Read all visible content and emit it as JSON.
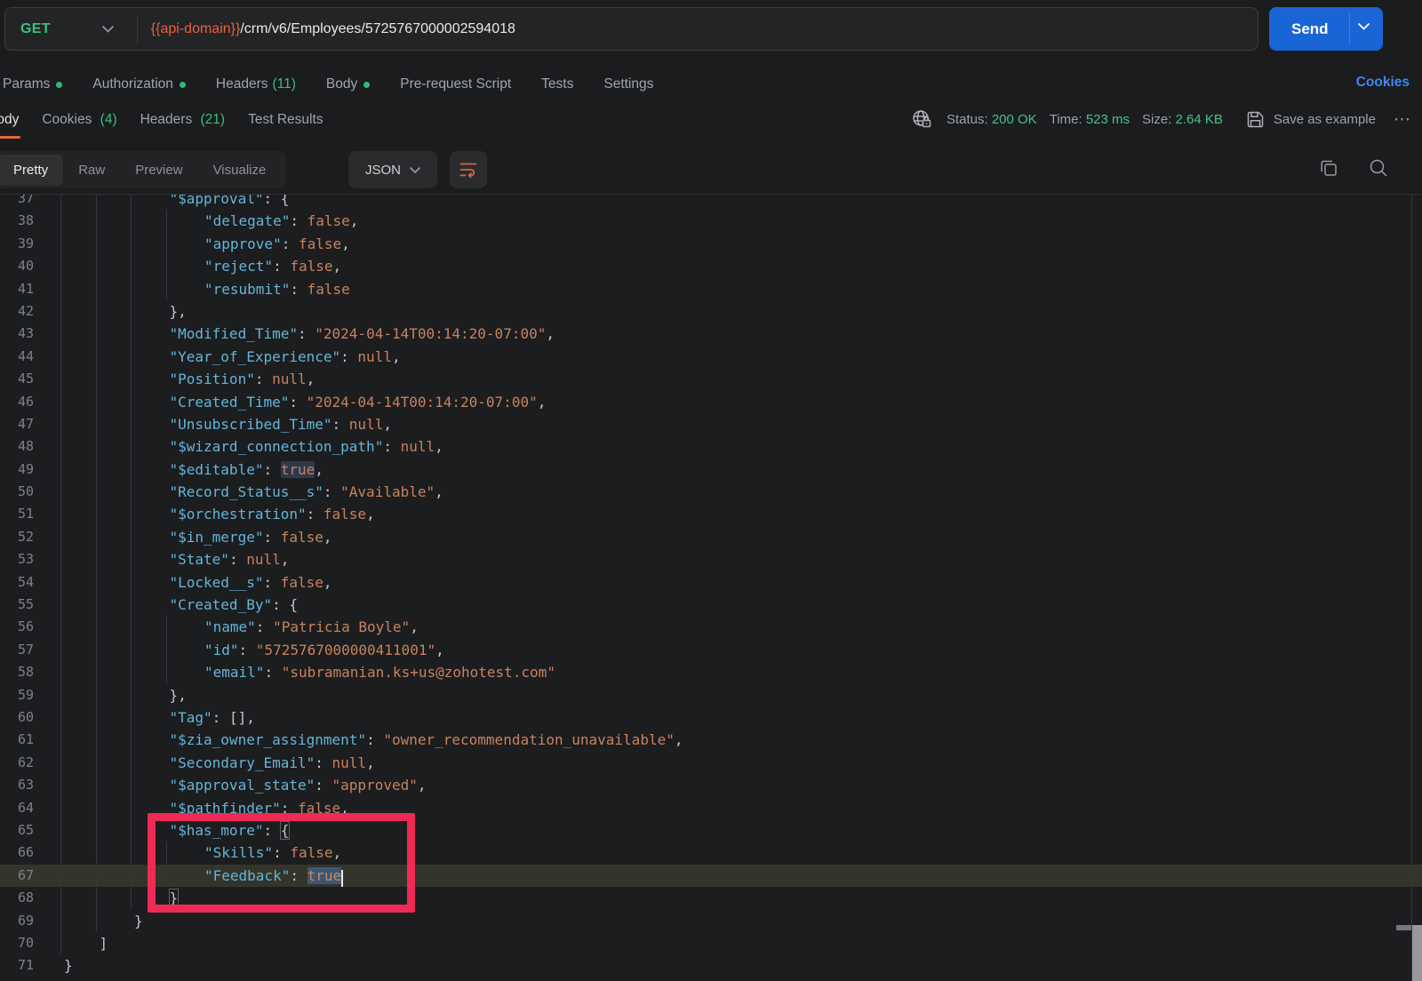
{
  "request": {
    "method": "GET",
    "url_variable": "{{api-domain}}",
    "url_path": "/crm/v6/Employees/5725767000002594018",
    "send_label": "Send"
  },
  "request_tabs": {
    "params": "Params",
    "authorization": "Authorization",
    "headers": "Headers",
    "headers_count": "(11)",
    "body": "Body",
    "prerequest": "Pre-request Script",
    "tests": "Tests",
    "settings": "Settings",
    "cookies_link": "Cookies"
  },
  "response_tabs": {
    "body": "Body",
    "cookies": "Cookies",
    "cookies_count": "(4)",
    "headers": "Headers",
    "headers_count": "(21)",
    "test_results": "Test Results"
  },
  "response_status": {
    "status_label": "Status:",
    "status_value": "200 OK",
    "time_label": "Time:",
    "time_value": "523 ms",
    "size_label": "Size:",
    "size_value": "2.64 KB",
    "save_as_example": "Save as example",
    "more": "⋯"
  },
  "viewer": {
    "pretty": "Pretty",
    "raw": "Raw",
    "preview": "Preview",
    "visualize": "Visualize",
    "language": "JSON"
  },
  "colors": {
    "method_green": "#3abf7d",
    "accent_orange": "#e4673d",
    "send_blue": "#1a65d6",
    "link_blue": "#4086f4",
    "status_green": "#45c386",
    "json_key": "#64b5da",
    "json_value": "#c9825e",
    "annotation_red": "#ee2a55"
  },
  "code": {
    "lines": [
      {
        "n": "37",
        "i": 3,
        "t": [
          [
            "k",
            "\"$approval\""
          ],
          [
            "p",
            ": {"
          ]
        ]
      },
      {
        "n": "38",
        "i": 4,
        "t": [
          [
            "k",
            "\"delegate\""
          ],
          [
            "p",
            ": "
          ],
          [
            "v",
            "false"
          ],
          [
            "p",
            ","
          ]
        ]
      },
      {
        "n": "39",
        "i": 4,
        "t": [
          [
            "k",
            "\"approve\""
          ],
          [
            "p",
            ": "
          ],
          [
            "v",
            "false"
          ],
          [
            "p",
            ","
          ]
        ]
      },
      {
        "n": "40",
        "i": 4,
        "t": [
          [
            "k",
            "\"reject\""
          ],
          [
            "p",
            ": "
          ],
          [
            "v",
            "false"
          ],
          [
            "p",
            ","
          ]
        ]
      },
      {
        "n": "41",
        "i": 4,
        "t": [
          [
            "k",
            "\"resubmit\""
          ],
          [
            "p",
            ": "
          ],
          [
            "v",
            "false"
          ]
        ]
      },
      {
        "n": "42",
        "i": 3,
        "t": [
          [
            "p",
            "},"
          ]
        ]
      },
      {
        "n": "43",
        "i": 3,
        "t": [
          [
            "k",
            "\"Modified_Time\""
          ],
          [
            "p",
            ": "
          ],
          [
            "s",
            "\"2024-04-14T00:14:20-07:00\""
          ],
          [
            "p",
            ","
          ]
        ]
      },
      {
        "n": "44",
        "i": 3,
        "t": [
          [
            "k",
            "\"Year_of_Experience\""
          ],
          [
            "p",
            ": "
          ],
          [
            "v",
            "null"
          ],
          [
            "p",
            ","
          ]
        ]
      },
      {
        "n": "45",
        "i": 3,
        "t": [
          [
            "k",
            "\"Position\""
          ],
          [
            "p",
            ": "
          ],
          [
            "v",
            "null"
          ],
          [
            "p",
            ","
          ]
        ]
      },
      {
        "n": "46",
        "i": 3,
        "t": [
          [
            "k",
            "\"Created_Time\""
          ],
          [
            "p",
            ": "
          ],
          [
            "s",
            "\"2024-04-14T00:14:20-07:00\""
          ],
          [
            "p",
            ","
          ]
        ]
      },
      {
        "n": "47",
        "i": 3,
        "t": [
          [
            "k",
            "\"Unsubscribed_Time\""
          ],
          [
            "p",
            ": "
          ],
          [
            "v",
            "null"
          ],
          [
            "p",
            ","
          ]
        ]
      },
      {
        "n": "48",
        "i": 3,
        "t": [
          [
            "k",
            "\"$wizard_connection_path\""
          ],
          [
            "p",
            ": "
          ],
          [
            "v",
            "null"
          ],
          [
            "p",
            ","
          ]
        ]
      },
      {
        "n": "49",
        "i": 3,
        "t": [
          [
            "k",
            "\"$editable\""
          ],
          [
            "p",
            ": "
          ],
          [
            "h1",
            "true"
          ],
          [
            "p",
            ","
          ]
        ]
      },
      {
        "n": "50",
        "i": 3,
        "t": [
          [
            "k",
            "\"Record_Status__s\""
          ],
          [
            "p",
            ": "
          ],
          [
            "s",
            "\"Available\""
          ],
          [
            "p",
            ","
          ]
        ]
      },
      {
        "n": "51",
        "i": 3,
        "t": [
          [
            "k",
            "\"$orchestration\""
          ],
          [
            "p",
            ": "
          ],
          [
            "v",
            "false"
          ],
          [
            "p",
            ","
          ]
        ]
      },
      {
        "n": "52",
        "i": 3,
        "t": [
          [
            "k",
            "\"$in_merge\""
          ],
          [
            "p",
            ": "
          ],
          [
            "v",
            "false"
          ],
          [
            "p",
            ","
          ]
        ]
      },
      {
        "n": "53",
        "i": 3,
        "t": [
          [
            "k",
            "\"State\""
          ],
          [
            "p",
            ": "
          ],
          [
            "v",
            "null"
          ],
          [
            "p",
            ","
          ]
        ]
      },
      {
        "n": "54",
        "i": 3,
        "t": [
          [
            "k",
            "\"Locked__s\""
          ],
          [
            "p",
            ": "
          ],
          [
            "v",
            "false"
          ],
          [
            "p",
            ","
          ]
        ]
      },
      {
        "n": "55",
        "i": 3,
        "t": [
          [
            "k",
            "\"Created_By\""
          ],
          [
            "p",
            ": {"
          ]
        ]
      },
      {
        "n": "56",
        "i": 4,
        "t": [
          [
            "k",
            "\"name\""
          ],
          [
            "p",
            ": "
          ],
          [
            "s",
            "\"Patricia Boyle\""
          ],
          [
            "p",
            ","
          ]
        ]
      },
      {
        "n": "57",
        "i": 4,
        "t": [
          [
            "k",
            "\"id\""
          ],
          [
            "p",
            ": "
          ],
          [
            "s",
            "\"5725767000000411001\""
          ],
          [
            "p",
            ","
          ]
        ]
      },
      {
        "n": "58",
        "i": 4,
        "t": [
          [
            "k",
            "\"email\""
          ],
          [
            "p",
            ": "
          ],
          [
            "s",
            "\"subramanian.ks+us@zohotest.com\""
          ]
        ]
      },
      {
        "n": "59",
        "i": 3,
        "t": [
          [
            "p",
            "},"
          ]
        ]
      },
      {
        "n": "60",
        "i": 3,
        "t": [
          [
            "k",
            "\"Tag\""
          ],
          [
            "p",
            ": [],"
          ]
        ]
      },
      {
        "n": "61",
        "i": 3,
        "t": [
          [
            "k",
            "\"$zia_owner_assignment\""
          ],
          [
            "p",
            ": "
          ],
          [
            "s",
            "\"owner_recommendation_unavailable\""
          ],
          [
            "p",
            ","
          ]
        ]
      },
      {
        "n": "62",
        "i": 3,
        "t": [
          [
            "k",
            "\"Secondary_Email\""
          ],
          [
            "p",
            ": "
          ],
          [
            "v",
            "null"
          ],
          [
            "p",
            ","
          ]
        ]
      },
      {
        "n": "63",
        "i": 3,
        "t": [
          [
            "k",
            "\"$approval_state\""
          ],
          [
            "p",
            ": "
          ],
          [
            "s",
            "\"approved\""
          ],
          [
            "p",
            ","
          ]
        ]
      },
      {
        "n": "64",
        "i": 3,
        "t": [
          [
            "k",
            "\"$pathfinder\""
          ],
          [
            "p",
            ": "
          ],
          [
            "v",
            "false"
          ],
          [
            "p",
            ","
          ]
        ]
      },
      {
        "n": "65",
        "i": 3,
        "t": [
          [
            "k",
            "\"$has_more\""
          ],
          [
            "p",
            ": "
          ],
          [
            "m",
            "{"
          ]
        ]
      },
      {
        "n": "66",
        "i": 4,
        "t": [
          [
            "k",
            "\"Skills\""
          ],
          [
            "p",
            ": "
          ],
          [
            "v",
            "false"
          ],
          [
            "p",
            ","
          ]
        ]
      },
      {
        "n": "67",
        "i": 4,
        "a": true,
        "t": [
          [
            "k",
            "\"Feedback\""
          ],
          [
            "p",
            ": "
          ],
          [
            "h2",
            "true"
          ],
          [
            "c",
            ""
          ]
        ]
      },
      {
        "n": "68",
        "i": 3,
        "t": [
          [
            "m",
            "}"
          ]
        ]
      },
      {
        "n": "69",
        "i": 2,
        "t": [
          [
            "p",
            "}"
          ]
        ]
      },
      {
        "n": "70",
        "i": 1,
        "t": [
          [
            "p",
            "]"
          ]
        ]
      },
      {
        "n": "71",
        "i": 0,
        "t": [
          [
            "p",
            "}"
          ]
        ]
      }
    ]
  }
}
